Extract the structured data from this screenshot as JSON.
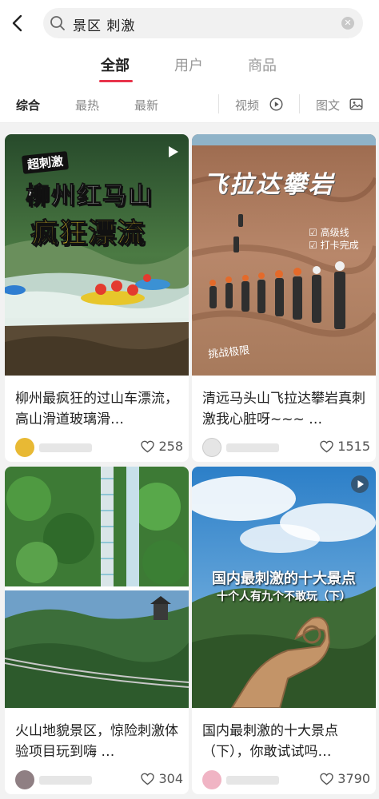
{
  "search": {
    "query": "景区 刺激"
  },
  "tabs": [
    {
      "label": "全部"
    },
    {
      "label": "用户"
    },
    {
      "label": "商品"
    }
  ],
  "filters": {
    "sort": [
      "综合",
      "最热",
      "最新"
    ],
    "video_label": "视频",
    "image_label": "图文"
  },
  "cards": [
    {
      "title": "柳州最疯狂的过山车漂流，高山滑道玻璃滑…",
      "likes": "258",
      "overlay_tag": "超刺激",
      "overlay_line1": "柳州红马山",
      "overlay_line2": "疯狂漂流",
      "is_video": true
    },
    {
      "title": "清远马头山飞拉达攀岩真刺激我心脏呀~~~ …",
      "likes": "1515",
      "overlay_line1": "飞拉达攀岩",
      "overlay_note1": "☑ 高级线",
      "overlay_note2": "☑ 打卡完成",
      "overlay_note3": "挑战极限",
      "is_video": false
    },
    {
      "title": "火山地貌景区，惊险刺激体验项目玩到嗨 …",
      "likes": "304",
      "is_video": false
    },
    {
      "title": "国内最刺激的十大景点（下），你敢试试吗…",
      "likes": "3790",
      "overlay_line1": "国内最刺激的十大景点",
      "overlay_line2": "十个人有九个不敢玩（下）",
      "is_video": true
    }
  ],
  "colors": {
    "accent": "#e8344b",
    "text": "#222222",
    "muted": "#999999"
  }
}
